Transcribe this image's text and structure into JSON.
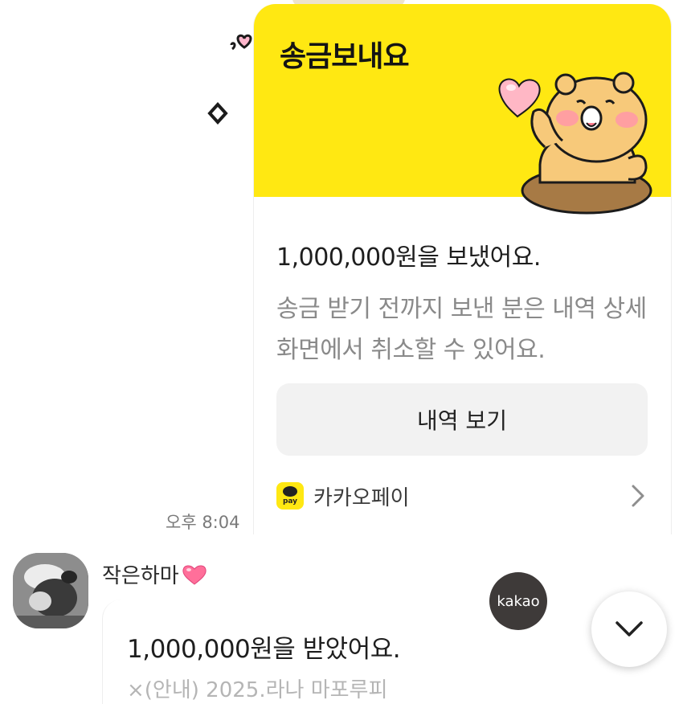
{
  "transfer_card": {
    "title": "송금보내요",
    "amount_text": "1,000,000원을 보냈어요.",
    "description": "송금 받기 전까지 보낸 분은 내역 상세화면에서 취소할 수 있어요.",
    "history_button_label": "내역 보기",
    "brand_name": "카카오페이",
    "brand_logo_tag": "pay",
    "header_color": "#FFE812"
  },
  "timestamp": "오후 8:04",
  "incoming_message": {
    "sender_name": "작은하마",
    "amount_text": "1,000,000원을 받았어요.",
    "sub_text": "×(안내) 2025.라나 마포루피"
  },
  "kakao_badge_label": "kakao",
  "icons": {
    "heart": "heart-icon",
    "sparkle": "sparkle-icon",
    "chevron_right": "chevron-right-icon",
    "chevron_down": "chevron-down-icon"
  }
}
